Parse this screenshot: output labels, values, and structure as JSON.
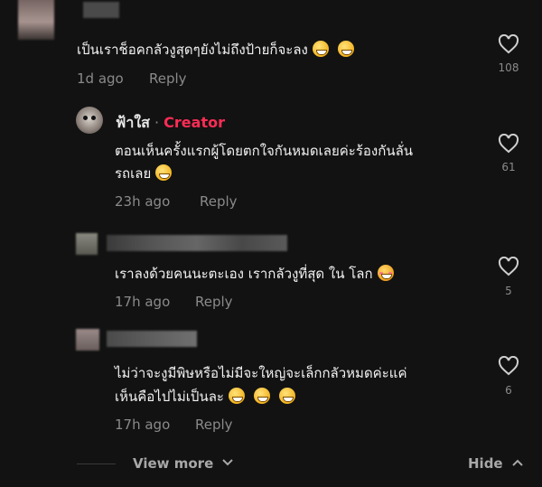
{
  "comments": [
    {
      "text": "เป็นเราช็อคกลัวงูสุดๆยังไม่ถึงป้ายก็จะลง",
      "time": "1d ago",
      "reply_label": "Reply",
      "likes": "108"
    },
    {
      "author": "ฟ้าใส",
      "author_sep": "·",
      "badge": "Creator",
      "text_line1": "ตอนเห็นครั้งแรกผู้โดยตกใจกันหมดเลยค่ะร้องกันลั่น",
      "text_line2": "รถเลย",
      "time": "23h ago",
      "reply_label": "Reply",
      "likes": "61"
    },
    {
      "text": "เราลงด้วยคนนะตะเอง เรากลัวงูที่สุด ใน โลก",
      "time": "17h ago",
      "reply_label": "Reply",
      "likes": "5"
    },
    {
      "text_line1": "ไม่ว่าจะงูมีพิษหรือไม่มีจะใหญ่จะเล็กกลัวหมดค่ะแค่",
      "text_line2": "เห็นคือไปไม่เป็นละ",
      "time": "17h ago",
      "reply_label": "Reply",
      "likes": "6"
    }
  ],
  "footer": {
    "view_more": "View more",
    "hide": "Hide"
  },
  "colors": {
    "creator_badge": "#fe2c55",
    "muted": "#8a8a8a",
    "background": "#121212"
  },
  "icons": [
    "heart-icon",
    "chevron-down-icon",
    "chevron-up-icon",
    "emoji-grin-icon",
    "emoji-love-icon"
  ]
}
